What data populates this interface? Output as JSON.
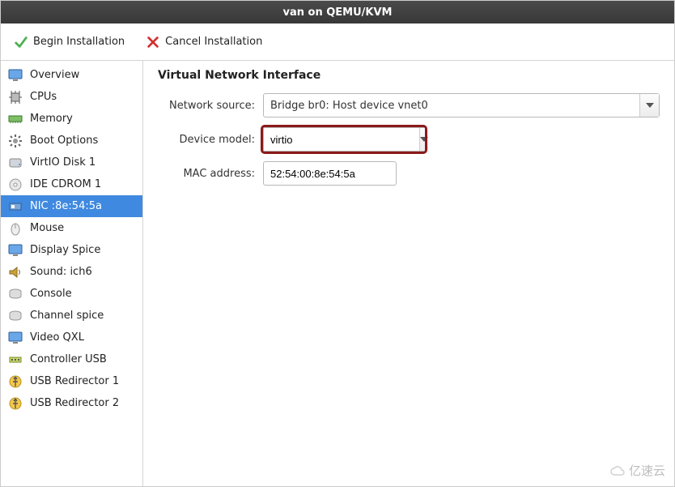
{
  "title": "van on QEMU/KVM",
  "toolbar": {
    "begin_label": "Begin Installation",
    "cancel_label": "Cancel Installation"
  },
  "sidebar": {
    "items": [
      {
        "label": "Overview",
        "icon": "monitor"
      },
      {
        "label": "CPUs",
        "icon": "cpu"
      },
      {
        "label": "Memory",
        "icon": "memory"
      },
      {
        "label": "Boot Options",
        "icon": "gear"
      },
      {
        "label": "VirtIO Disk 1",
        "icon": "disk"
      },
      {
        "label": "IDE CDROM 1",
        "icon": "cdrom"
      },
      {
        "label": "NIC :8e:54:5a",
        "icon": "nic",
        "selected": true
      },
      {
        "label": "Mouse",
        "icon": "mouse"
      },
      {
        "label": "Display Spice",
        "icon": "monitor"
      },
      {
        "label": "Sound: ich6",
        "icon": "sound"
      },
      {
        "label": "Console",
        "icon": "console"
      },
      {
        "label": "Channel spice",
        "icon": "console"
      },
      {
        "label": "Video QXL",
        "icon": "monitor"
      },
      {
        "label": "Controller USB",
        "icon": "usb-hub"
      },
      {
        "label": "USB Redirector 1",
        "icon": "usb"
      },
      {
        "label": "USB Redirector 2",
        "icon": "usb"
      }
    ]
  },
  "panel": {
    "heading": "Virtual Network Interface",
    "network_source_label": "Network source:",
    "network_source_value": "Bridge br0: Host device vnet0",
    "device_model_label": "Device model:",
    "device_model_value": "virtio",
    "mac_label": "MAC address:",
    "mac_value": "52:54:00:8e:54:5a"
  },
  "watermark": "亿速云"
}
